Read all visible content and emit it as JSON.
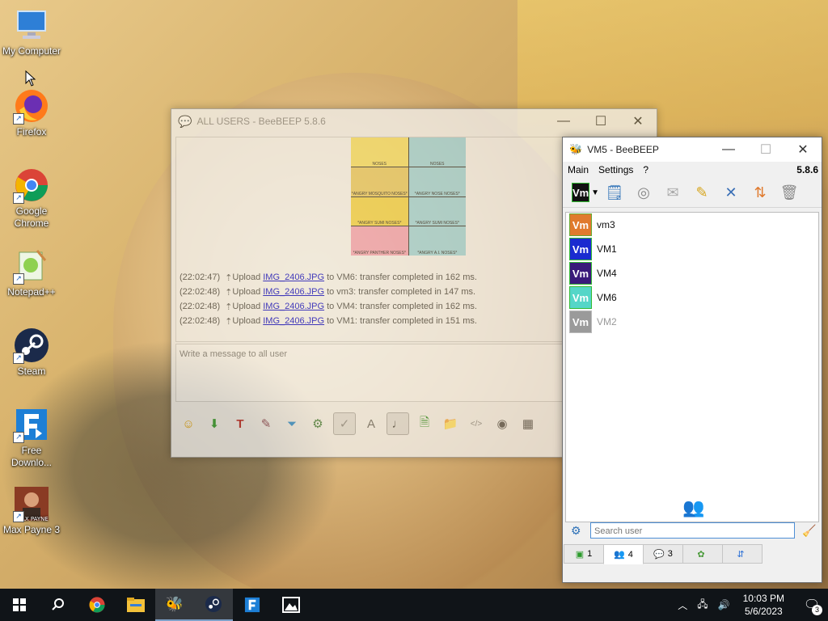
{
  "desktop": {
    "icons": [
      {
        "label": "My Computer"
      },
      {
        "label": "Firefox"
      },
      {
        "label": "Google Chrome"
      },
      {
        "label": "Notepad++"
      },
      {
        "label": "Steam"
      },
      {
        "label": "Free Downlo..."
      },
      {
        "label": "Max Payne 3"
      }
    ]
  },
  "allusers_window": {
    "title": "ALL USERS - BeeBEEP 5.8.6",
    "log": [
      {
        "time": "(22:02:47)",
        "action": "Upload",
        "file": "IMG_2406.JPG",
        "rest": "to VM6: transfer completed in 162 ms."
      },
      {
        "time": "(22:02:48)",
        "action": "Upload",
        "file": "IMG_2406.JPG",
        "rest": "to vm3: transfer completed in 147 ms."
      },
      {
        "time": "(22:02:48)",
        "action": "Upload",
        "file": "IMG_2406.JPG",
        "rest": "to VM4: transfer completed in 162 ms."
      },
      {
        "time": "(22:02:48)",
        "action": "Upload",
        "file": "IMG_2406.JPG",
        "rest": "to VM1: transfer completed in 151 ms."
      }
    ],
    "message_placeholder": "Write a message to all user",
    "meme_captions": [
      "NOSES",
      "NOSES",
      "*ANGRY MOSQUITO NOSES*",
      "*ANGRY NOSE NOSES*",
      "*ANGRY SUMI NOSES*",
      "*ANGRY SUMI NOSES*",
      "*ANGRY PANTHER NOSES*",
      "*ANGRY A.I. NOSES*"
    ]
  },
  "vm5_window": {
    "title": "VM5 - BeeBEEP",
    "menu": [
      "Main",
      "Settings",
      "?"
    ],
    "version": "5.8.6",
    "users": [
      {
        "name": "vm3",
        "badge": "Vm",
        "color": "#e07a2e"
      },
      {
        "name": "VM1",
        "badge": "Vm",
        "color": "#1a2bd0"
      },
      {
        "name": "VM4",
        "badge": "Vm",
        "color": "#3a1a7a"
      },
      {
        "name": "VM6",
        "badge": "Vm",
        "color": "#55d6c8"
      },
      {
        "name": "VM2",
        "badge": "Vm",
        "color": "#9a9a9a",
        "offline": true
      }
    ],
    "toolbar_badge": "Vm",
    "search_placeholder": "Search user",
    "tabs": [
      {
        "count": "1"
      },
      {
        "count": "4"
      },
      {
        "count": "3"
      },
      {
        "count": ""
      },
      {
        "count": ""
      }
    ]
  },
  "taskbar": {
    "time": "10:03 PM",
    "date": "5/6/2023",
    "notifications": "3"
  }
}
